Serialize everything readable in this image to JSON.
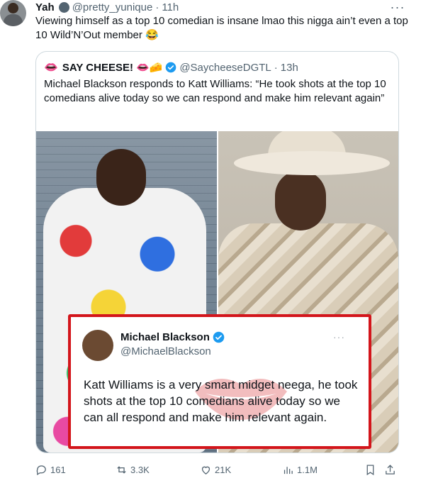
{
  "tweet": {
    "author_name": "Yah",
    "handle": "@pretty_yunique",
    "separator": "·",
    "time": "11h",
    "text": "Viewing himself as a top 10 comedian is insane lmao this nigga ain’t even a top 10 Wild’N’Out member 😂",
    "more_label": "···"
  },
  "quote": {
    "author_name": "SAY CHEESE!",
    "author_emojis": "👄🧀",
    "handle": "@SaycheeseDGTL",
    "separator": "·",
    "time": "13h",
    "text": "Michael Blackson responds to Katt Williams: “He took shots at the top 10 comedians alive today so we can respond and make him relevant again”",
    "embedded_post": {
      "name": "Michael Blackson",
      "handle": "@MichaelBlackson",
      "more_label": "···",
      "text": "Katt Williams is a very smart midget neega, he took shots at the top 10 comedians alive today so we can all respond and make him relevant again."
    }
  },
  "actions": {
    "replies": "161",
    "reposts": "3.3K",
    "likes": "21K",
    "views": "1.1M"
  },
  "colors": {
    "verified": "#1d9bf0",
    "highlight_border": "#d3151b",
    "muted": "#536471"
  },
  "icons": [
    "reply-icon",
    "repost-icon",
    "like-icon",
    "views-icon",
    "bookmark-icon",
    "share-icon",
    "verified-badge-icon"
  ]
}
